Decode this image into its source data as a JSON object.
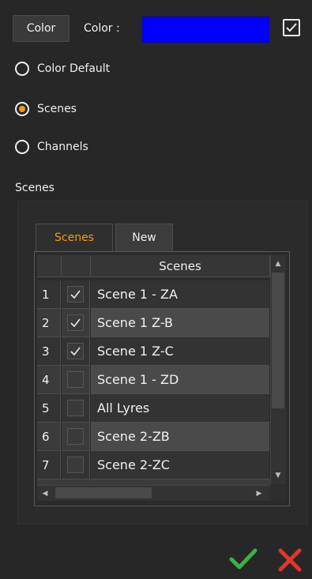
{
  "top": {
    "color_button": "Color",
    "color_label": "Color :",
    "color_value": "#0000ff",
    "checked": true
  },
  "radios": [
    {
      "label": "Color Default",
      "selected": false
    },
    {
      "label": "Scenes",
      "selected": true
    },
    {
      "label": "Channels",
      "selected": false
    }
  ],
  "section_label": "Scenes",
  "tabs": [
    {
      "label": "Scenes",
      "active": true
    },
    {
      "label": "New",
      "active": false
    }
  ],
  "table": {
    "header": "Scenes",
    "rows": [
      {
        "num": "1",
        "checked": true,
        "name": "Scene 1 - ZA"
      },
      {
        "num": "2",
        "checked": true,
        "name": "Scene 1 Z-B"
      },
      {
        "num": "3",
        "checked": true,
        "name": "Scene 1 Z-C"
      },
      {
        "num": "4",
        "checked": false,
        "name": "Scene 1 - ZD"
      },
      {
        "num": "5",
        "checked": false,
        "name": "All Lyres"
      },
      {
        "num": "6",
        "checked": false,
        "name": "Scene 2-ZB"
      },
      {
        "num": "7",
        "checked": false,
        "name": "Scene 2-ZC"
      }
    ]
  },
  "colors": {
    "accent": "#f39c12",
    "ok": "#3cb043",
    "cancel": "#e0362c"
  },
  "icons": {
    "ok": "check-mark-icon",
    "cancel": "x-cross-icon"
  }
}
